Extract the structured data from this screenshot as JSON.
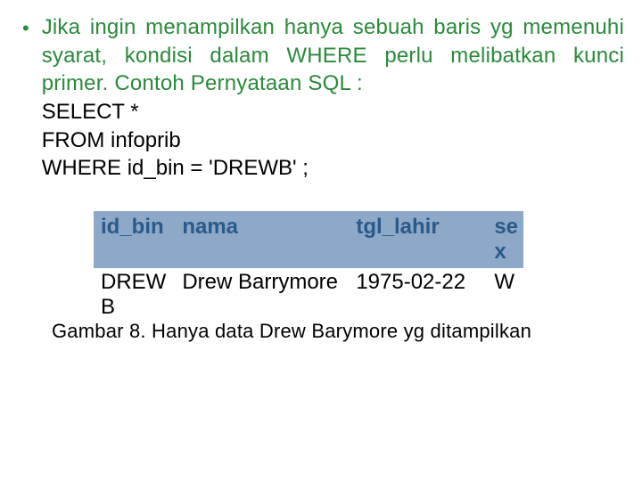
{
  "bullet": {
    "intro": "Jika ingin menampilkan hanya sebuah baris yg memenuhi syarat, kondisi dalam WHERE perlu melibatkan kunci primer. Contoh Pernyataan SQL :",
    "sql1": "SELECT *",
    "sql2": "FROM infoprib",
    "sql3": "WHERE id_bin =  'DREWB'  ;"
  },
  "table": {
    "headers": {
      "id_bin": "id_bin",
      "nama": "nama",
      "tgl_lahir": "tgl_lahir",
      "sex": "se x"
    },
    "rows": [
      {
        "id_bin": "DREW B",
        "nama": "Drew Barrymore",
        "tgl_lahir": "1975-02-22",
        "sex": "W"
      }
    ]
  },
  "caption": "Gambar 8. Hanya data Drew Barymore yg ditampilkan"
}
